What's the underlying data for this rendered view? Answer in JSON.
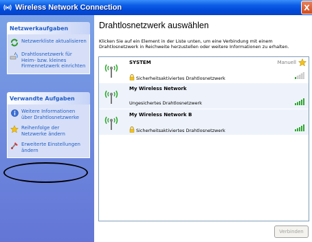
{
  "window": {
    "title": "Wireless Network Connection",
    "close_label": "X"
  },
  "sidebar": {
    "panels": [
      {
        "heading": "Netzwerkaufgaben",
        "tasks": [
          {
            "label": "Netzwerkliste aktualisieren",
            "icon": "refresh-icon"
          },
          {
            "label": "Drahtlosnetzwerk für\nHeim- bzw. kleines\nFirmennetzwerk einrichten",
            "icon": "setup-network-icon"
          }
        ]
      },
      {
        "heading": "Verwandte Aufgaben",
        "tasks": [
          {
            "label": "Weitere Informationen\nüber Drahtlosnetzwerke",
            "icon": "info-icon"
          },
          {
            "label": "Reihenfolge der\nNetzwerke ändern",
            "icon": "star-icon"
          },
          {
            "label": "Erweiterte Einstellungen\nändern",
            "icon": "settings-icon"
          }
        ]
      }
    ]
  },
  "main": {
    "title": "Drahtlosnetzwerk auswählen",
    "description": "Klicken Sie auf ein Element in der Liste unten, um eine Verbindung mit einem\nDrahtlosnetzwerk in Reichweite herzustellen oder weitere Informationen zu erhalten.",
    "networks": [
      {
        "name": "SYSTEM",
        "security": "Sicherheitsaktiviertes Drahtlosnetzwerk",
        "secured": true,
        "mode": "Manuell",
        "preferred": true,
        "signal_bars": 1
      },
      {
        "name": "My Wireless Network",
        "security": "Ungesichertes Drahtlosnetzwerk",
        "secured": false,
        "mode": "",
        "preferred": false,
        "signal_bars": 5
      },
      {
        "name": "My Wireless Network B",
        "security": "Sicherheitsaktiviertes Drahtlosnetzwerk",
        "secured": true,
        "mode": "",
        "preferred": false,
        "signal_bars": 5
      }
    ],
    "connect_label": "Verbinden"
  },
  "colors": {
    "titlebar": "#0049d8",
    "sidebar": "#6375d6",
    "link": "#215dc6",
    "signal": "#2fa62f"
  }
}
